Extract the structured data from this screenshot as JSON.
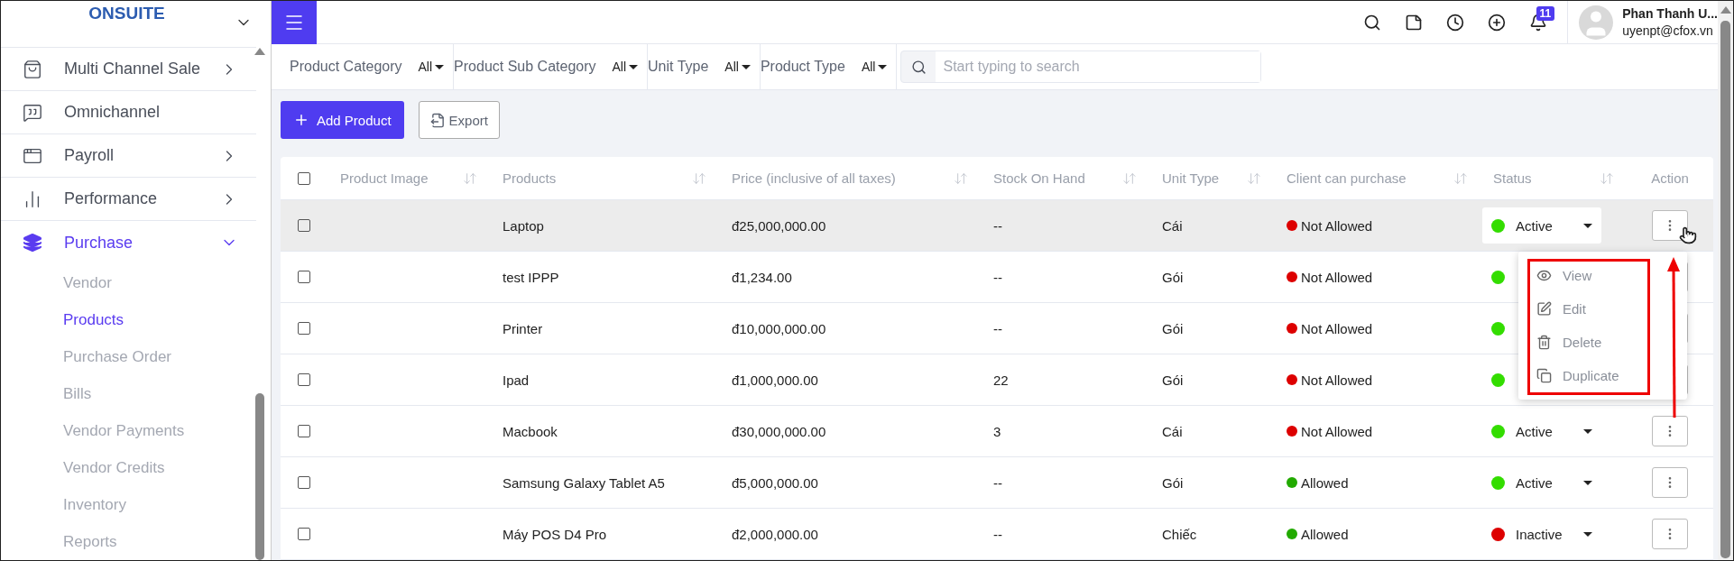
{
  "sidebar": {
    "brand": "ONSUITE",
    "items": [
      {
        "label": "Multi Channel Sale",
        "expandable": true,
        "expanded": false,
        "selected": false
      },
      {
        "label": "Omnichannel",
        "expandable": false,
        "expanded": false,
        "selected": false
      },
      {
        "label": "Payroll",
        "expandable": true,
        "expanded": false,
        "selected": false
      },
      {
        "label": "Performance",
        "expandable": true,
        "expanded": false,
        "selected": false
      },
      {
        "label": "Purchase",
        "expandable": true,
        "expanded": true,
        "selected": true,
        "children": [
          {
            "label": "Vendor",
            "selected": false
          },
          {
            "label": "Products",
            "selected": true
          },
          {
            "label": "Purchase Order",
            "selected": false
          },
          {
            "label": "Bills",
            "selected": false
          },
          {
            "label": "Vendor Payments",
            "selected": false
          },
          {
            "label": "Vendor Credits",
            "selected": false
          },
          {
            "label": "Inventory",
            "selected": false
          },
          {
            "label": "Reports",
            "selected": false
          }
        ]
      }
    ]
  },
  "topbar": {
    "notifications": "11",
    "user": {
      "name": "Phan Thanh U...",
      "email": "uyenpt@cfox.vn"
    }
  },
  "filters": [
    {
      "label": "Product Category",
      "value": "All"
    },
    {
      "label": "Product Sub Category",
      "value": "All"
    },
    {
      "label": "Unit Type",
      "value": "All"
    },
    {
      "label": "Product Type",
      "value": "All"
    }
  ],
  "search": {
    "placeholder": "Start typing to search"
  },
  "buttons": {
    "add": "Add Product",
    "export": "Export"
  },
  "table": {
    "header_checked": false,
    "columns": [
      "Product Image",
      "Products",
      "Price (inclusive of all taxes)",
      "Stock On Hand",
      "Unit Type",
      "Client can purchase",
      "Status",
      "Action"
    ],
    "rows": [
      {
        "selected": true,
        "checked": false,
        "menu_open": true,
        "product": "Laptop",
        "price": "đ25,000,000.00",
        "stock": "--",
        "unit": "Cái",
        "client": {
          "label": "Not Allowed",
          "color": "#dd0000"
        },
        "status": {
          "label": "Active",
          "color": "#33dd00"
        }
      },
      {
        "selected": false,
        "checked": false,
        "menu_open": false,
        "product": "test IPPP",
        "price": "đ1,234.00",
        "stock": "--",
        "unit": "Gói",
        "client": {
          "label": "Not Allowed",
          "color": "#dd0000"
        },
        "status": {
          "color": "#33dd00"
        }
      },
      {
        "selected": false,
        "checked": false,
        "menu_open": false,
        "product": "Printer",
        "price": "đ10,000,000.00",
        "stock": "--",
        "unit": "Gói",
        "client": {
          "label": "Not Allowed",
          "color": "#dd0000"
        },
        "status": {
          "color": "#33dd00"
        }
      },
      {
        "selected": false,
        "checked": false,
        "menu_open": false,
        "product": "Ipad",
        "price": "đ1,000,000.00",
        "stock": "22",
        "unit": "Gói",
        "client": {
          "label": "Not Allowed",
          "color": "#dd0000"
        },
        "status": {
          "color": "#33dd00"
        }
      },
      {
        "selected": false,
        "checked": false,
        "menu_open": false,
        "product": "Macbook",
        "price": "đ30,000,000.00",
        "stock": "3",
        "unit": "Cái",
        "client": {
          "label": "Not Allowed",
          "color": "#dd0000"
        },
        "status": {
          "label": "Active",
          "color": "#33dd00"
        }
      },
      {
        "selected": false,
        "checked": false,
        "menu_open": false,
        "product": "Samsung Galaxy Tablet A5",
        "price": "đ5,000,000.00",
        "stock": "--",
        "unit": "Gói",
        "client": {
          "label": "Allowed",
          "color": "#22aa00"
        },
        "status": {
          "label": "Active",
          "color": "#33dd00"
        }
      },
      {
        "selected": false,
        "checked": false,
        "menu_open": false,
        "product": "Máy POS D4 Pro",
        "price": "đ2,000,000.00",
        "stock": "--",
        "unit": "Chiếc",
        "client": {
          "label": "Allowed",
          "color": "#22aa00"
        },
        "status": {
          "label": "Inactive",
          "color": "#dd0000"
        }
      }
    ]
  },
  "action_menu": {
    "items": [
      "View",
      "Edit",
      "Delete",
      "Duplicate"
    ],
    "annotations": {
      "box": true,
      "arrow": true
    }
  }
}
